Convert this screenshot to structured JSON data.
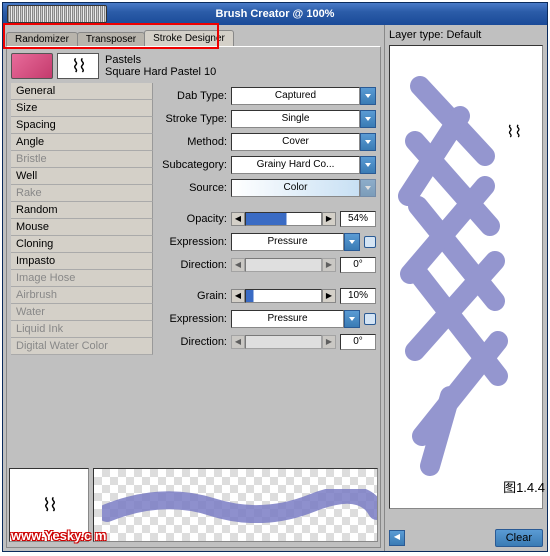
{
  "window": {
    "title": "Brush Creator @ 100%"
  },
  "tabs": {
    "randomizer": "Randomizer",
    "transposer": "Transposer",
    "stroke": "Stroke Designer"
  },
  "category": {
    "name": "Pastels",
    "variant": "Square Hard Pastel 10"
  },
  "sidebar": {
    "items": [
      {
        "label": "General",
        "enabled": true
      },
      {
        "label": "Size",
        "enabled": true
      },
      {
        "label": "Spacing",
        "enabled": true
      },
      {
        "label": "Angle",
        "enabled": true
      },
      {
        "label": "Bristle",
        "enabled": false
      },
      {
        "label": "Well",
        "enabled": true
      },
      {
        "label": "Rake",
        "enabled": false
      },
      {
        "label": "Random",
        "enabled": true
      },
      {
        "label": "Mouse",
        "enabled": true
      },
      {
        "label": "Cloning",
        "enabled": true
      },
      {
        "label": "Impasto",
        "enabled": true
      },
      {
        "label": "Image Hose",
        "enabled": false
      },
      {
        "label": "Airbrush",
        "enabled": false
      },
      {
        "label": "Water",
        "enabled": false
      },
      {
        "label": "Liquid Ink",
        "enabled": false
      },
      {
        "label": "Digital Water Color",
        "enabled": false
      }
    ]
  },
  "params": {
    "dab_type": {
      "label": "Dab Type:",
      "value": "Captured"
    },
    "stroke_type": {
      "label": "Stroke Type:",
      "value": "Single"
    },
    "method": {
      "label": "Method:",
      "value": "Cover"
    },
    "subcategory": {
      "label": "Subcategory:",
      "value": "Grainy Hard Co..."
    },
    "source": {
      "label": "Source:",
      "value": "Color"
    },
    "opacity": {
      "label": "Opacity:",
      "value": "54%"
    },
    "expression1": {
      "label": "Expression:",
      "value": "Pressure"
    },
    "direction1": {
      "label": "Direction:",
      "value": "0°"
    },
    "grain": {
      "label": "Grain:",
      "value": "10%"
    },
    "expression2": {
      "label": "Expression:",
      "value": "Pressure"
    },
    "direction2": {
      "label": "Direction:",
      "value": "0°"
    }
  },
  "right": {
    "layer_type": "Layer type: Default",
    "clear": "Clear",
    "fig": "图1.4.4"
  },
  "watermark": "www.Yesky.c   m",
  "colors": {
    "accent": "#3a7bb4",
    "stroke": "#7a7cc4"
  }
}
